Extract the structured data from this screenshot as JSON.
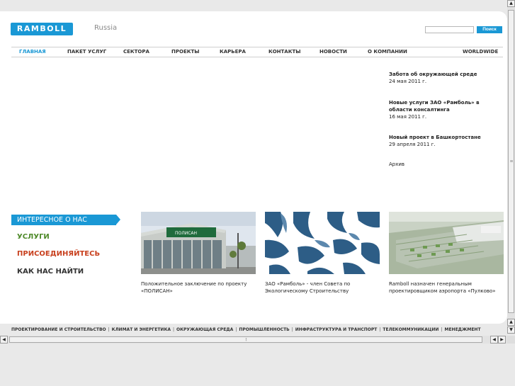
{
  "header": {
    "logo_text": "RAMBOLL",
    "country": "Russia",
    "search_button": "Поиск",
    "search_value": ""
  },
  "nav": {
    "items": [
      {
        "label": "ГЛАВНАЯ",
        "active": true
      },
      {
        "label": "ПАКЕТ УСЛУГ"
      },
      {
        "label": "СЕКТОРА"
      },
      {
        "label": "ПРОЕКТЫ"
      },
      {
        "label": "КАРЬЕРА"
      },
      {
        "label": "КОНТАКТЫ"
      },
      {
        "label": "НОВОСТИ"
      },
      {
        "label": "О КОМПАНИИ"
      },
      {
        "label": "WORLDWIDE"
      }
    ]
  },
  "news": {
    "items": [
      {
        "title": "Забота об окружающей среде",
        "date": "24 мая 2011 г."
      },
      {
        "title": "Новые услуги ЗАО «Рамболь» в области консалтинга",
        "date": "16 мая 2011 г."
      },
      {
        "title": "Новый проект в Башкортостане",
        "date": "29 апреля 2011 г."
      }
    ],
    "archive_label": "Архив"
  },
  "side_menu": {
    "active": "ИНТЕРЕСНОЕ О НАС",
    "links": [
      {
        "label": "УСЛУГИ",
        "color": "#4f8a2a"
      },
      {
        "label": "ПРИСОЕДИНЯЙТЕСЬ",
        "color": "#c8401e"
      },
      {
        "label": "КАК НАС НАЙТИ",
        "color": "#333333"
      }
    ]
  },
  "promos": [
    {
      "caption": "Положительное заключение по проекту «ПОЛИСАН»",
      "image": "building-photo"
    },
    {
      "caption": "ЗАО «Рамболь» - член Совета по Экологическому Строительству",
      "image": "leaf-pattern"
    },
    {
      "caption": "Ramboll назначен генеральным проектировщиком аэропорта «Пулково»",
      "image": "airport-render"
    }
  ],
  "footer": {
    "links": [
      "ПРОЕКТИРОВАНИЕ И СТРОИТЕЛЬСТВО",
      "КЛИМАТ И ЭНЕРГЕТИКА",
      "ОКРУЖАЮЩАЯ СРЕДА",
      "ПРОМЫШЛЕННОСТЬ",
      "ИНФРАСТРУКТУРА И ТРАНСПОРТ",
      "ТЕЛЕКОММУНИКАЦИИ",
      "МЕНЕДЖМЕНТ"
    ]
  },
  "colors": {
    "accent": "#1a98d5"
  }
}
